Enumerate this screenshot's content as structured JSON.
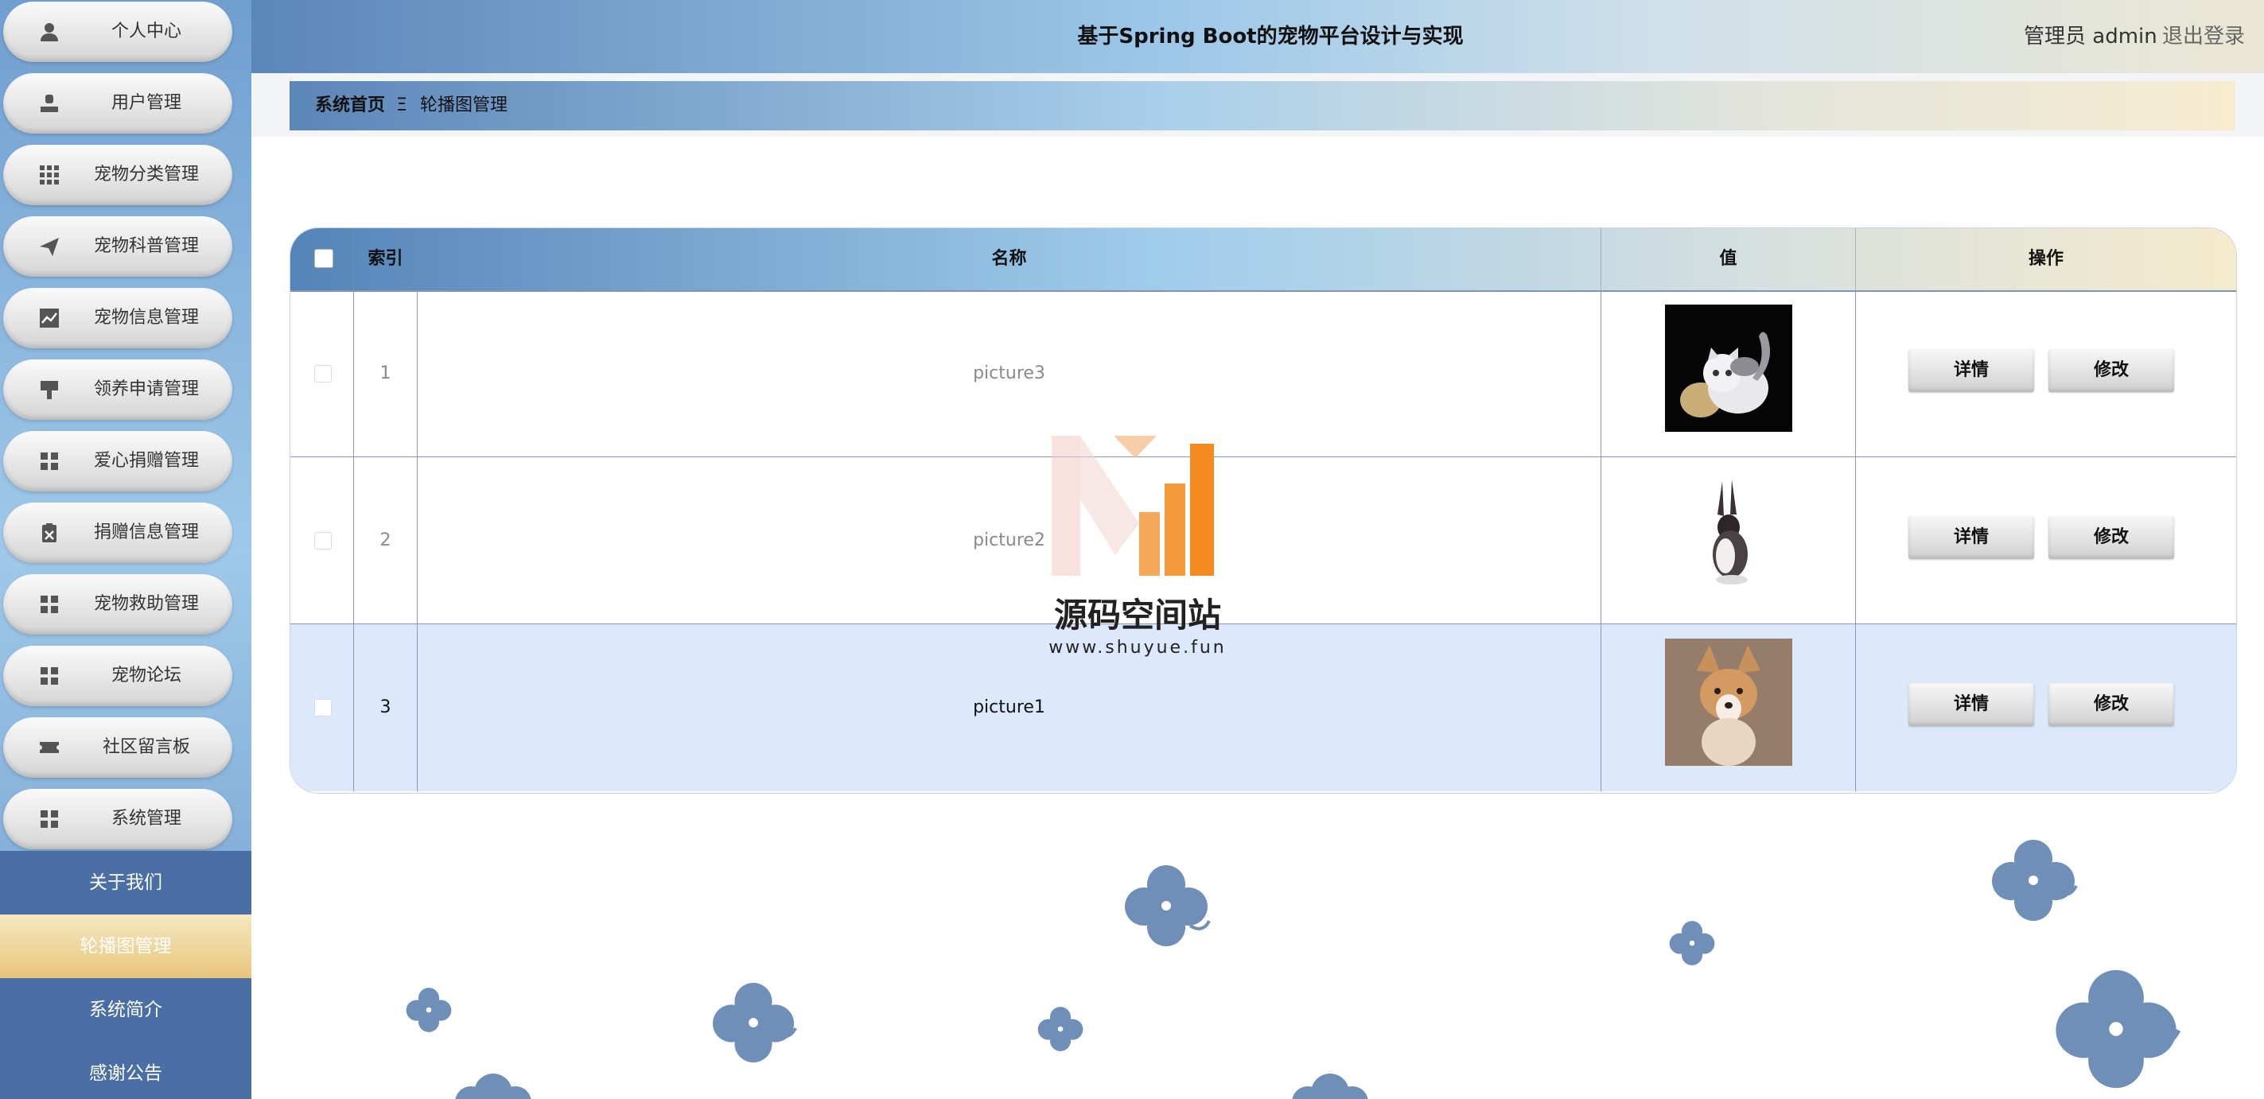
{
  "header": {
    "title": "基于Spring Boot的宠物平台设计与实现",
    "user_label": "管理员 admin",
    "logout_label": "退出登录"
  },
  "sidebar": {
    "menu": [
      {
        "label": "个人中心",
        "icon": "person-icon"
      },
      {
        "label": "用户管理",
        "icon": "user-icon"
      },
      {
        "label": "宠物分类管理",
        "icon": "grid-icon"
      },
      {
        "label": "宠物科普管理",
        "icon": "send-icon"
      },
      {
        "label": "宠物信息管理",
        "icon": "chart-icon"
      },
      {
        "label": "领养申请管理",
        "icon": "flag-icon"
      },
      {
        "label": "爱心捐赠管理",
        "icon": "apps-icon"
      },
      {
        "label": "捐赠信息管理",
        "icon": "clipboard-icon"
      },
      {
        "label": "宠物救助管理",
        "icon": "apps-icon"
      },
      {
        "label": "宠物论坛",
        "icon": "apps-icon"
      },
      {
        "label": "社区留言板",
        "icon": "ticket-icon"
      },
      {
        "label": "系统管理",
        "icon": "apps-icon"
      }
    ],
    "submenu": [
      {
        "label": "关于我们",
        "active": false
      },
      {
        "label": "轮播图管理",
        "active": true
      },
      {
        "label": "系统简介",
        "active": false
      },
      {
        "label": "感谢公告",
        "active": false
      }
    ]
  },
  "breadcrumb": {
    "home": "系统首页",
    "separator": "Ξ",
    "current": "轮播图管理"
  },
  "table": {
    "columns": [
      "索引",
      "名称",
      "值",
      "操作"
    ],
    "rows": [
      {
        "index": "1",
        "name": "picture3",
        "image": "cat-photo",
        "detail": "详情",
        "edit": "修改"
      },
      {
        "index": "2",
        "name": "picture2",
        "image": "rabbit-photo",
        "detail": "详情",
        "edit": "修改"
      },
      {
        "index": "3",
        "name": "picture1",
        "image": "puppy-photo",
        "detail": "详情",
        "edit": "修改"
      }
    ]
  },
  "watermark": {
    "name": "源码空间站",
    "url": "www.shuyue.fun"
  },
  "colors": {
    "accent": "#4a6fa5",
    "active": "#e8c57e",
    "highlight_row": "#dce9fc",
    "flower": "#6f8fb8"
  }
}
